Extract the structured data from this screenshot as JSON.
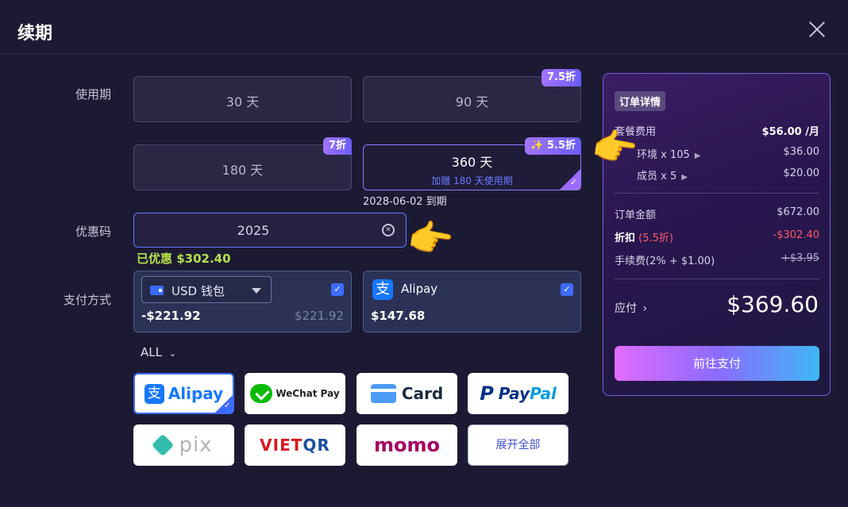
{
  "header": {
    "title": "续期"
  },
  "labels": {
    "period": "使用期",
    "coupon": "优惠码",
    "payment": "支付方式"
  },
  "plans": [
    {
      "name": "30 天"
    },
    {
      "name": "90 天",
      "badge": "7.5折"
    },
    {
      "name": "180 天",
      "badge": "7折"
    },
    {
      "name": "360 天",
      "badge": "✨ 5.5折",
      "sub": "加赠 180 天使用期",
      "selected": true
    }
  ],
  "expire_text": "2028-06-02 到期",
  "coupon": {
    "value": "2025",
    "discount_note": "已优惠 $302.40"
  },
  "wallet": {
    "name": "USD 钱包",
    "amount": "-$221.92",
    "balance": "$221.92"
  },
  "alipay_split": {
    "name": "Alipay",
    "amount": "$147.68"
  },
  "all_toggle": "ALL",
  "methods": {
    "alipay": "Alipay",
    "wechat": "WeChat Pay",
    "card": "Card",
    "paypal_p": "P",
    "paypal_a": "Pay",
    "paypal_b": "Pal",
    "pix": "pix",
    "vietqr_a": "VIET",
    "vietqr_b": "QR",
    "momo": "momo",
    "expand": "展开全部"
  },
  "order": {
    "tag": "订单详情",
    "package_fee_label": "套餐费用",
    "package_fee_value": "$56.00 /月",
    "env_label": "环境 x 105",
    "env_value": "$36.00",
    "member_label": "成员 x 5",
    "member_value": "$20.00",
    "order_amount_label": "订单金额",
    "order_amount_value": "$672.00",
    "discount_label": "折扣",
    "discount_rate": "(5.5折)",
    "discount_value": "-$302.40",
    "fee_label": "手续费(2% + $1.00)",
    "fee_value": "+$3.95",
    "total_label": "应付",
    "total_value": "$369.60",
    "pay_button": "前往支付"
  },
  "colors": {
    "accent": "#8b7cff",
    "discount_green": "#b6e04a",
    "discount_red": "#ff5a6a"
  }
}
